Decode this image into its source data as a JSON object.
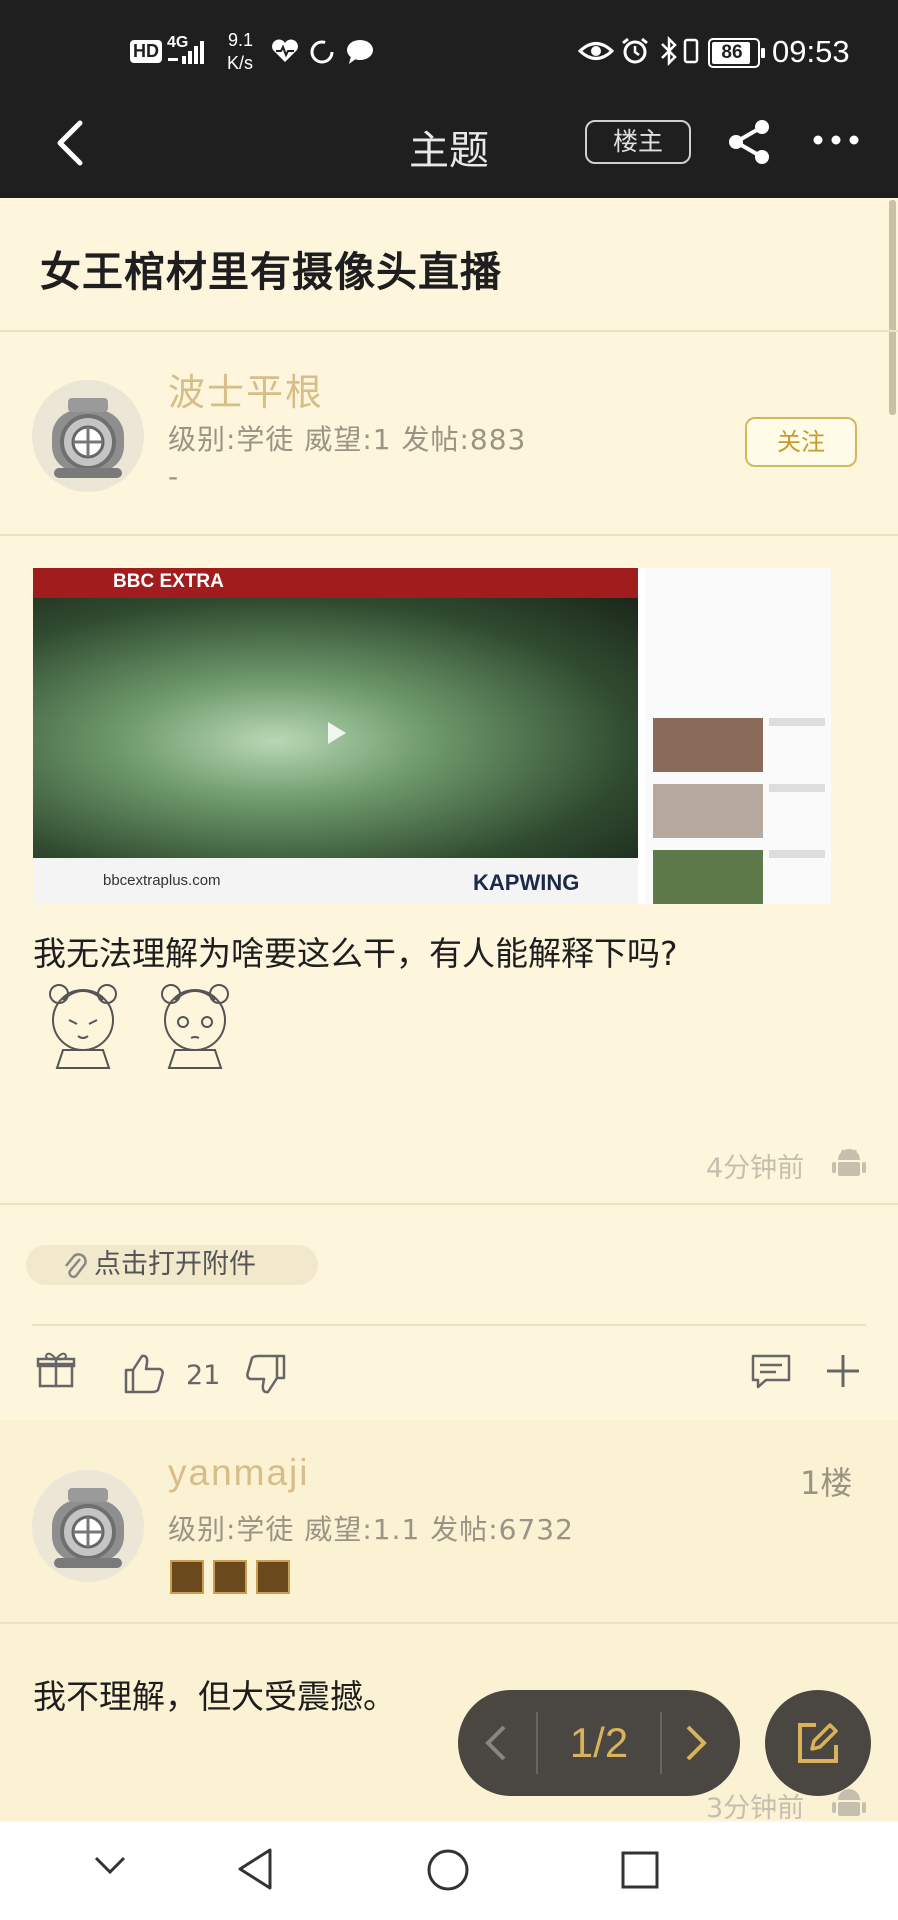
{
  "status_bar": {
    "hd": "HD",
    "network": "4G",
    "speed_value": "9.1",
    "speed_unit": "K/s",
    "battery": "86",
    "time": "09:53"
  },
  "nav": {
    "title": "主题",
    "owner_label": "楼主"
  },
  "post": {
    "title": "女王棺材里有摄像头直播",
    "author": {
      "name": "波士平根",
      "meta": "级别:学徒  威望:1  发帖:883",
      "extra": "-"
    },
    "follow_label": "关注",
    "image": {
      "top_brand": "BBC EXTRA",
      "watermark_left": "bbcextraplus.com",
      "watermark_right": "KAPWING"
    },
    "body": "我无法理解为啥要这么干，有人能解释下吗?",
    "timestamp": "4分钟前",
    "attachment_label": "点击打开附件",
    "like_count": "21"
  },
  "reply": {
    "author": {
      "name": "yanmaji",
      "meta": "级别:学徒  威望:1.1  发帖:6732"
    },
    "floor": "1楼",
    "body": "我不理解，但大受震撼。",
    "timestamp": "3分钟前"
  },
  "pager": {
    "label": "1/2"
  },
  "colors": {
    "bar_bg": "#1f1f1f",
    "page_bg": "#fdf5dc",
    "accent_gold": "#d8bd88"
  }
}
